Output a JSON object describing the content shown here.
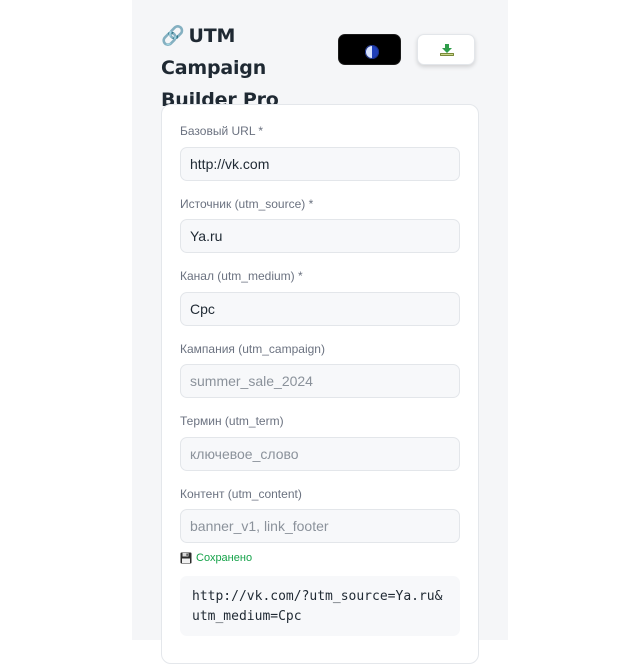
{
  "header": {
    "icon": "link-icon",
    "icon_glyph": "🔗",
    "title": "UTM Campaign Builder Pro",
    "theme_button_icon": "half-moon-icon",
    "export_button_icon": "download-icon"
  },
  "form": {
    "fields": [
      {
        "label": "Базовый URL *",
        "value": "http://vk.com",
        "placeholder": ""
      },
      {
        "label": "Источник (utm_source) *",
        "value": "Ya.ru",
        "placeholder": ""
      },
      {
        "label": "Канал (utm_medium) *",
        "value": "Cpc",
        "placeholder": ""
      },
      {
        "label": "Кампания (utm_campaign)",
        "value": "",
        "placeholder": "summer_sale_2024"
      },
      {
        "label": "Термин (utm_term)",
        "value": "",
        "placeholder": "ключевое_слово"
      },
      {
        "label": "Контент (utm_content)",
        "value": "",
        "placeholder": "banner_v1, link_footer"
      }
    ]
  },
  "status": {
    "icon": "floppy-disk-icon",
    "text": "Сохранено"
  },
  "result": {
    "url": "http://vk.com/?utm_source=Ya.ru&utm_medium=Cpc"
  },
  "colors": {
    "panel_bg": "#f5f6f8",
    "saved_green": "#16a34a",
    "theme_button_bg": "#000000"
  }
}
